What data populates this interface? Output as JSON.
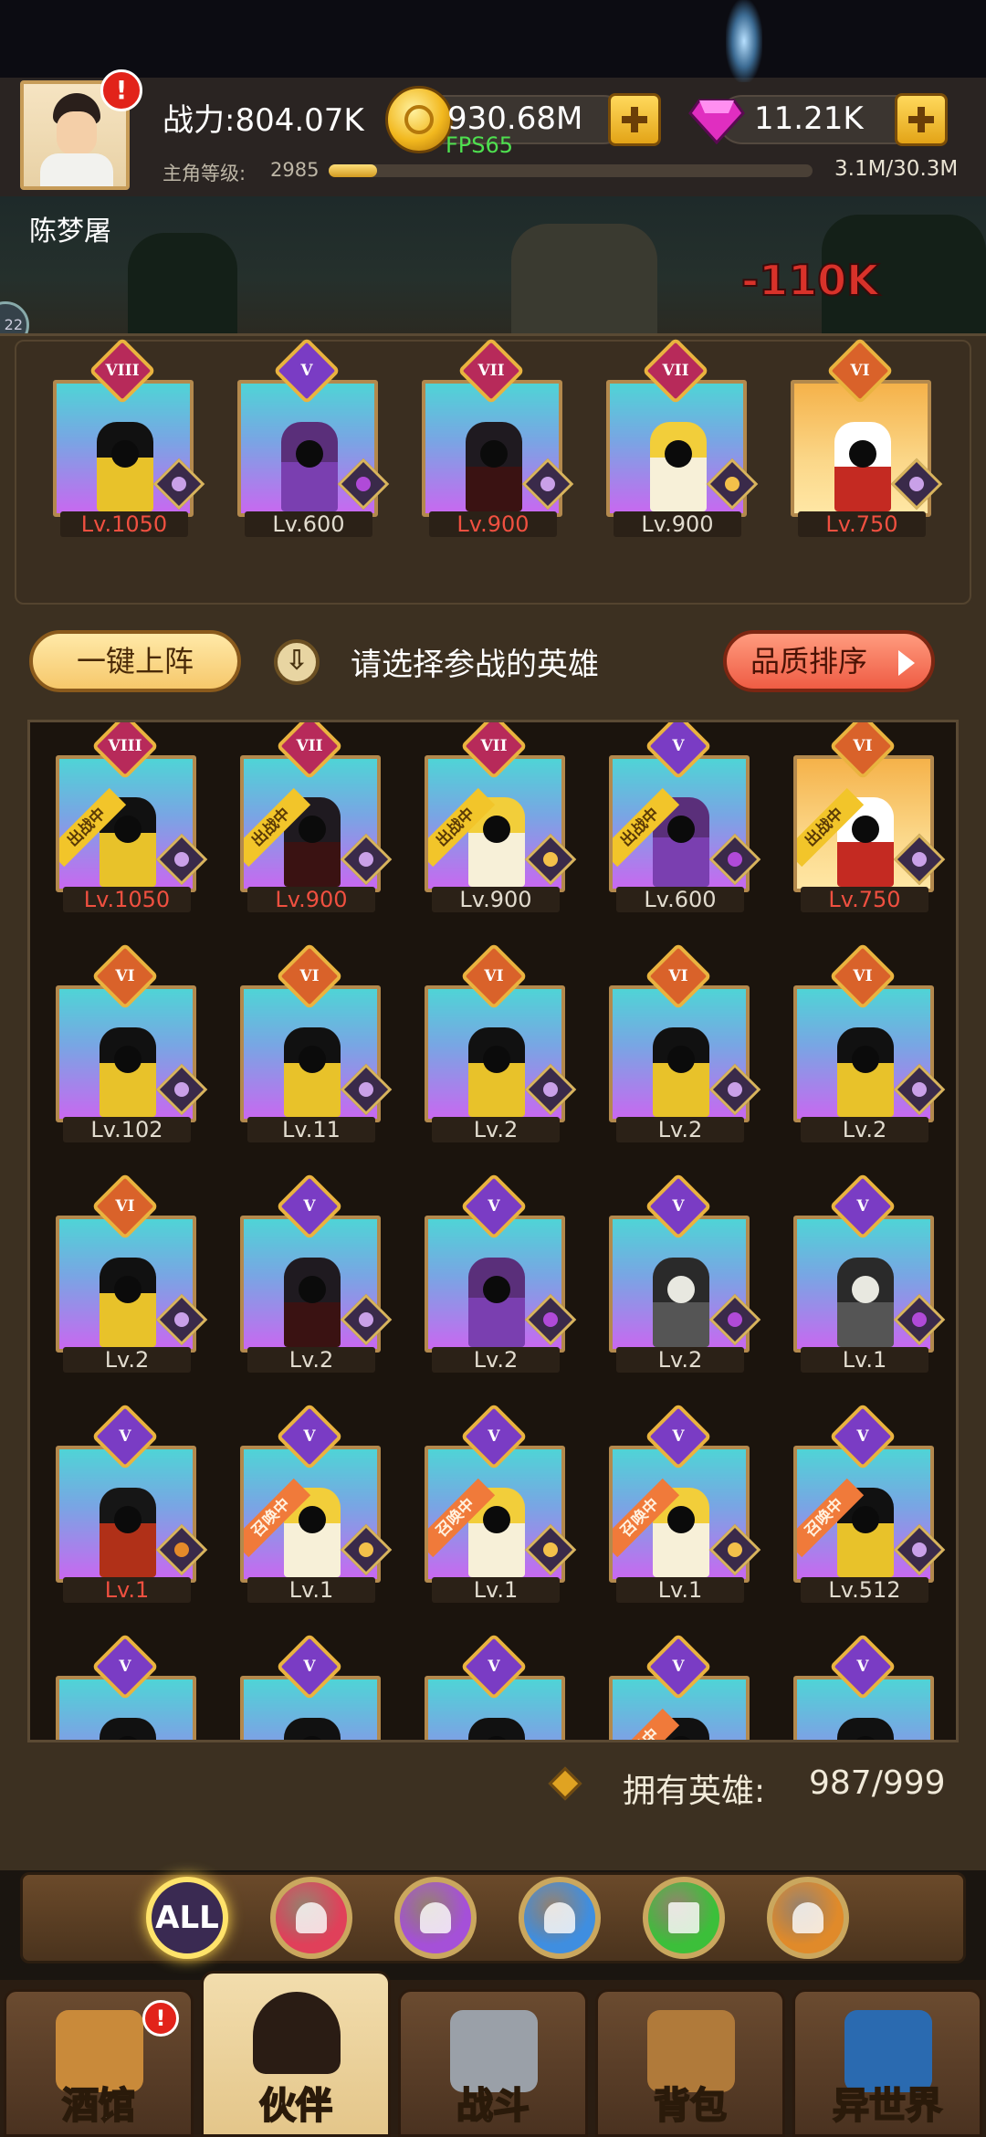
{
  "header": {
    "power_label": "战力:804.07K",
    "level_label": "主角等级:",
    "level_value": "2985",
    "exp_text": "3.1M/30.3M",
    "exp_progress": 0.1,
    "gold_value": "930.68M",
    "gem_value": "11.21K",
    "fps_text": "FPS65",
    "player_name": "陈梦屠",
    "alert_mark": "!"
  },
  "scene": {
    "damage_text": "-110K",
    "bubble_text": "22"
  },
  "lineup": {
    "heroes": [
      {
        "rank": "VIII",
        "level": "Lv.1050",
        "level_color": "red",
        "char": "yellow",
        "elem": "shield",
        "bg": "teal"
      },
      {
        "rank": "V",
        "level": "Lv.600",
        "level_color": "white",
        "char": "purple",
        "elem": "demon",
        "bg": "teal"
      },
      {
        "rank": "VII",
        "level": "Lv.900",
        "level_color": "red",
        "char": "dark",
        "elem": "shield",
        "bg": "teal"
      },
      {
        "rank": "VII",
        "level": "Lv.900",
        "level_color": "white",
        "char": "gold-white",
        "elem": "sun",
        "bg": "teal"
      },
      {
        "rank": "VI",
        "level": "Lv.750",
        "level_color": "red",
        "char": "white",
        "elem": "shield",
        "bg": "orange"
      }
    ]
  },
  "actions": {
    "auto_deploy": "一键上阵",
    "hint": "请选择参战的英雄",
    "sort": "品质排序"
  },
  "roster": {
    "ribbon_in_battle": "出战中",
    "ribbon_summon": "召唤中",
    "heroes": [
      {
        "rank": "VIII",
        "level": "Lv.1050",
        "level_color": "red",
        "char": "yellow",
        "elem": "shield",
        "ribbon": "battle",
        "bg": "teal"
      },
      {
        "rank": "VII",
        "level": "Lv.900",
        "level_color": "red",
        "char": "dark",
        "elem": "shield",
        "ribbon": "battle",
        "bg": "teal"
      },
      {
        "rank": "VII",
        "level": "Lv.900",
        "level_color": "white",
        "char": "gold-white",
        "elem": "sun",
        "ribbon": "battle",
        "bg": "teal"
      },
      {
        "rank": "V",
        "level": "Lv.600",
        "level_color": "white",
        "char": "purple",
        "elem": "demon",
        "ribbon": "battle",
        "bg": "teal"
      },
      {
        "rank": "VI",
        "level": "Lv.750",
        "level_color": "red",
        "char": "white",
        "elem": "shield",
        "ribbon": "battle",
        "bg": "orange"
      },
      {
        "rank": "VI",
        "level": "Lv.102",
        "level_color": "white",
        "char": "yellow",
        "elem": "shield",
        "ribbon": "",
        "bg": "teal"
      },
      {
        "rank": "VI",
        "level": "Lv.11",
        "level_color": "white",
        "char": "yellow",
        "elem": "shield",
        "ribbon": "",
        "bg": "teal"
      },
      {
        "rank": "VI",
        "level": "Lv.2",
        "level_color": "white",
        "char": "yellow",
        "elem": "shield",
        "ribbon": "",
        "bg": "teal"
      },
      {
        "rank": "VI",
        "level": "Lv.2",
        "level_color": "white",
        "char": "yellow",
        "elem": "shield",
        "ribbon": "",
        "bg": "teal"
      },
      {
        "rank": "VI",
        "level": "Lv.2",
        "level_color": "white",
        "char": "yellow",
        "elem": "shield",
        "ribbon": "",
        "bg": "teal"
      },
      {
        "rank": "VI",
        "level": "Lv.2",
        "level_color": "white",
        "char": "yellow",
        "elem": "shield",
        "ribbon": "",
        "bg": "teal"
      },
      {
        "rank": "V",
        "level": "Lv.2",
        "level_color": "white",
        "char": "dark",
        "elem": "shield",
        "ribbon": "",
        "bg": "teal"
      },
      {
        "rank": "V",
        "level": "Lv.2",
        "level_color": "white",
        "char": "purple",
        "elem": "demon",
        "ribbon": "",
        "bg": "teal"
      },
      {
        "rank": "V",
        "level": "Lv.2",
        "level_color": "white",
        "char": "reaper",
        "elem": "demon",
        "ribbon": "",
        "bg": "teal"
      },
      {
        "rank": "V",
        "level": "Lv.1",
        "level_color": "white",
        "char": "reaper",
        "elem": "demon",
        "ribbon": "",
        "bg": "teal"
      },
      {
        "rank": "V",
        "level": "Lv.1",
        "level_color": "red",
        "char": "red",
        "elem": "lion",
        "ribbon": "",
        "bg": "teal"
      },
      {
        "rank": "V",
        "level": "Lv.1",
        "level_color": "white",
        "char": "gold-white",
        "elem": "sun",
        "ribbon": "summon",
        "bg": "teal"
      },
      {
        "rank": "V",
        "level": "Lv.1",
        "level_color": "white",
        "char": "gold-white",
        "elem": "sun",
        "ribbon": "summon",
        "bg": "teal"
      },
      {
        "rank": "V",
        "level": "Lv.1",
        "level_color": "white",
        "char": "gold-white",
        "elem": "sun",
        "ribbon": "summon",
        "bg": "teal"
      },
      {
        "rank": "V",
        "level": "Lv.512",
        "level_color": "white",
        "char": "yellow",
        "elem": "shield",
        "ribbon": "summon",
        "bg": "teal"
      },
      {
        "rank": "V",
        "level": "",
        "level_color": "white",
        "char": "yellow",
        "elem": "shield",
        "ribbon": "",
        "bg": "teal"
      },
      {
        "rank": "V",
        "level": "",
        "level_color": "white",
        "char": "yellow",
        "elem": "shield",
        "ribbon": "",
        "bg": "teal"
      },
      {
        "rank": "V",
        "level": "",
        "level_color": "white",
        "char": "yellow",
        "elem": "shield",
        "ribbon": "",
        "bg": "teal"
      },
      {
        "rank": "V",
        "level": "",
        "level_color": "white",
        "char": "yellow",
        "elem": "shield",
        "ribbon": "summon",
        "bg": "teal"
      },
      {
        "rank": "V",
        "level": "",
        "level_color": "white",
        "char": "yellow",
        "elem": "shield",
        "ribbon": "",
        "bg": "teal"
      }
    ],
    "owned_label": "拥有英雄:",
    "owned_value": "987/999"
  },
  "filters": [
    {
      "label": "ALL",
      "icon": "all-icon",
      "color": "#3a2a52"
    },
    {
      "label": "",
      "icon": "sword-icon",
      "color": "#e0405a"
    },
    {
      "label": "",
      "icon": "staff-icon",
      "color": "#a550d8"
    },
    {
      "label": "",
      "icon": "dagger-icon",
      "color": "#3f8ee0"
    },
    {
      "label": "",
      "icon": "heal-cross-icon",
      "color": "#3cbf3a"
    },
    {
      "label": "",
      "icon": "shield-icon",
      "color": "#e08a2a"
    }
  ],
  "nav": {
    "tabs": [
      {
        "label": "酒馆",
        "icon": "tavern-mug-icon",
        "active": false
      },
      {
        "label": "伙伴",
        "icon": "partner-portrait-icon",
        "active": true
      },
      {
        "label": "战斗",
        "icon": "crossed-swords-icon",
        "active": false
      },
      {
        "label": "背包",
        "icon": "backpack-icon",
        "active": false
      },
      {
        "label": "异世界",
        "icon": "portal-icon",
        "active": false
      }
    ]
  },
  "colors": {
    "accent_gold": "#e9b33f",
    "level_red": "#f05040",
    "fps_green": "#4ee04f",
    "panel_brown": "#3c3021"
  }
}
